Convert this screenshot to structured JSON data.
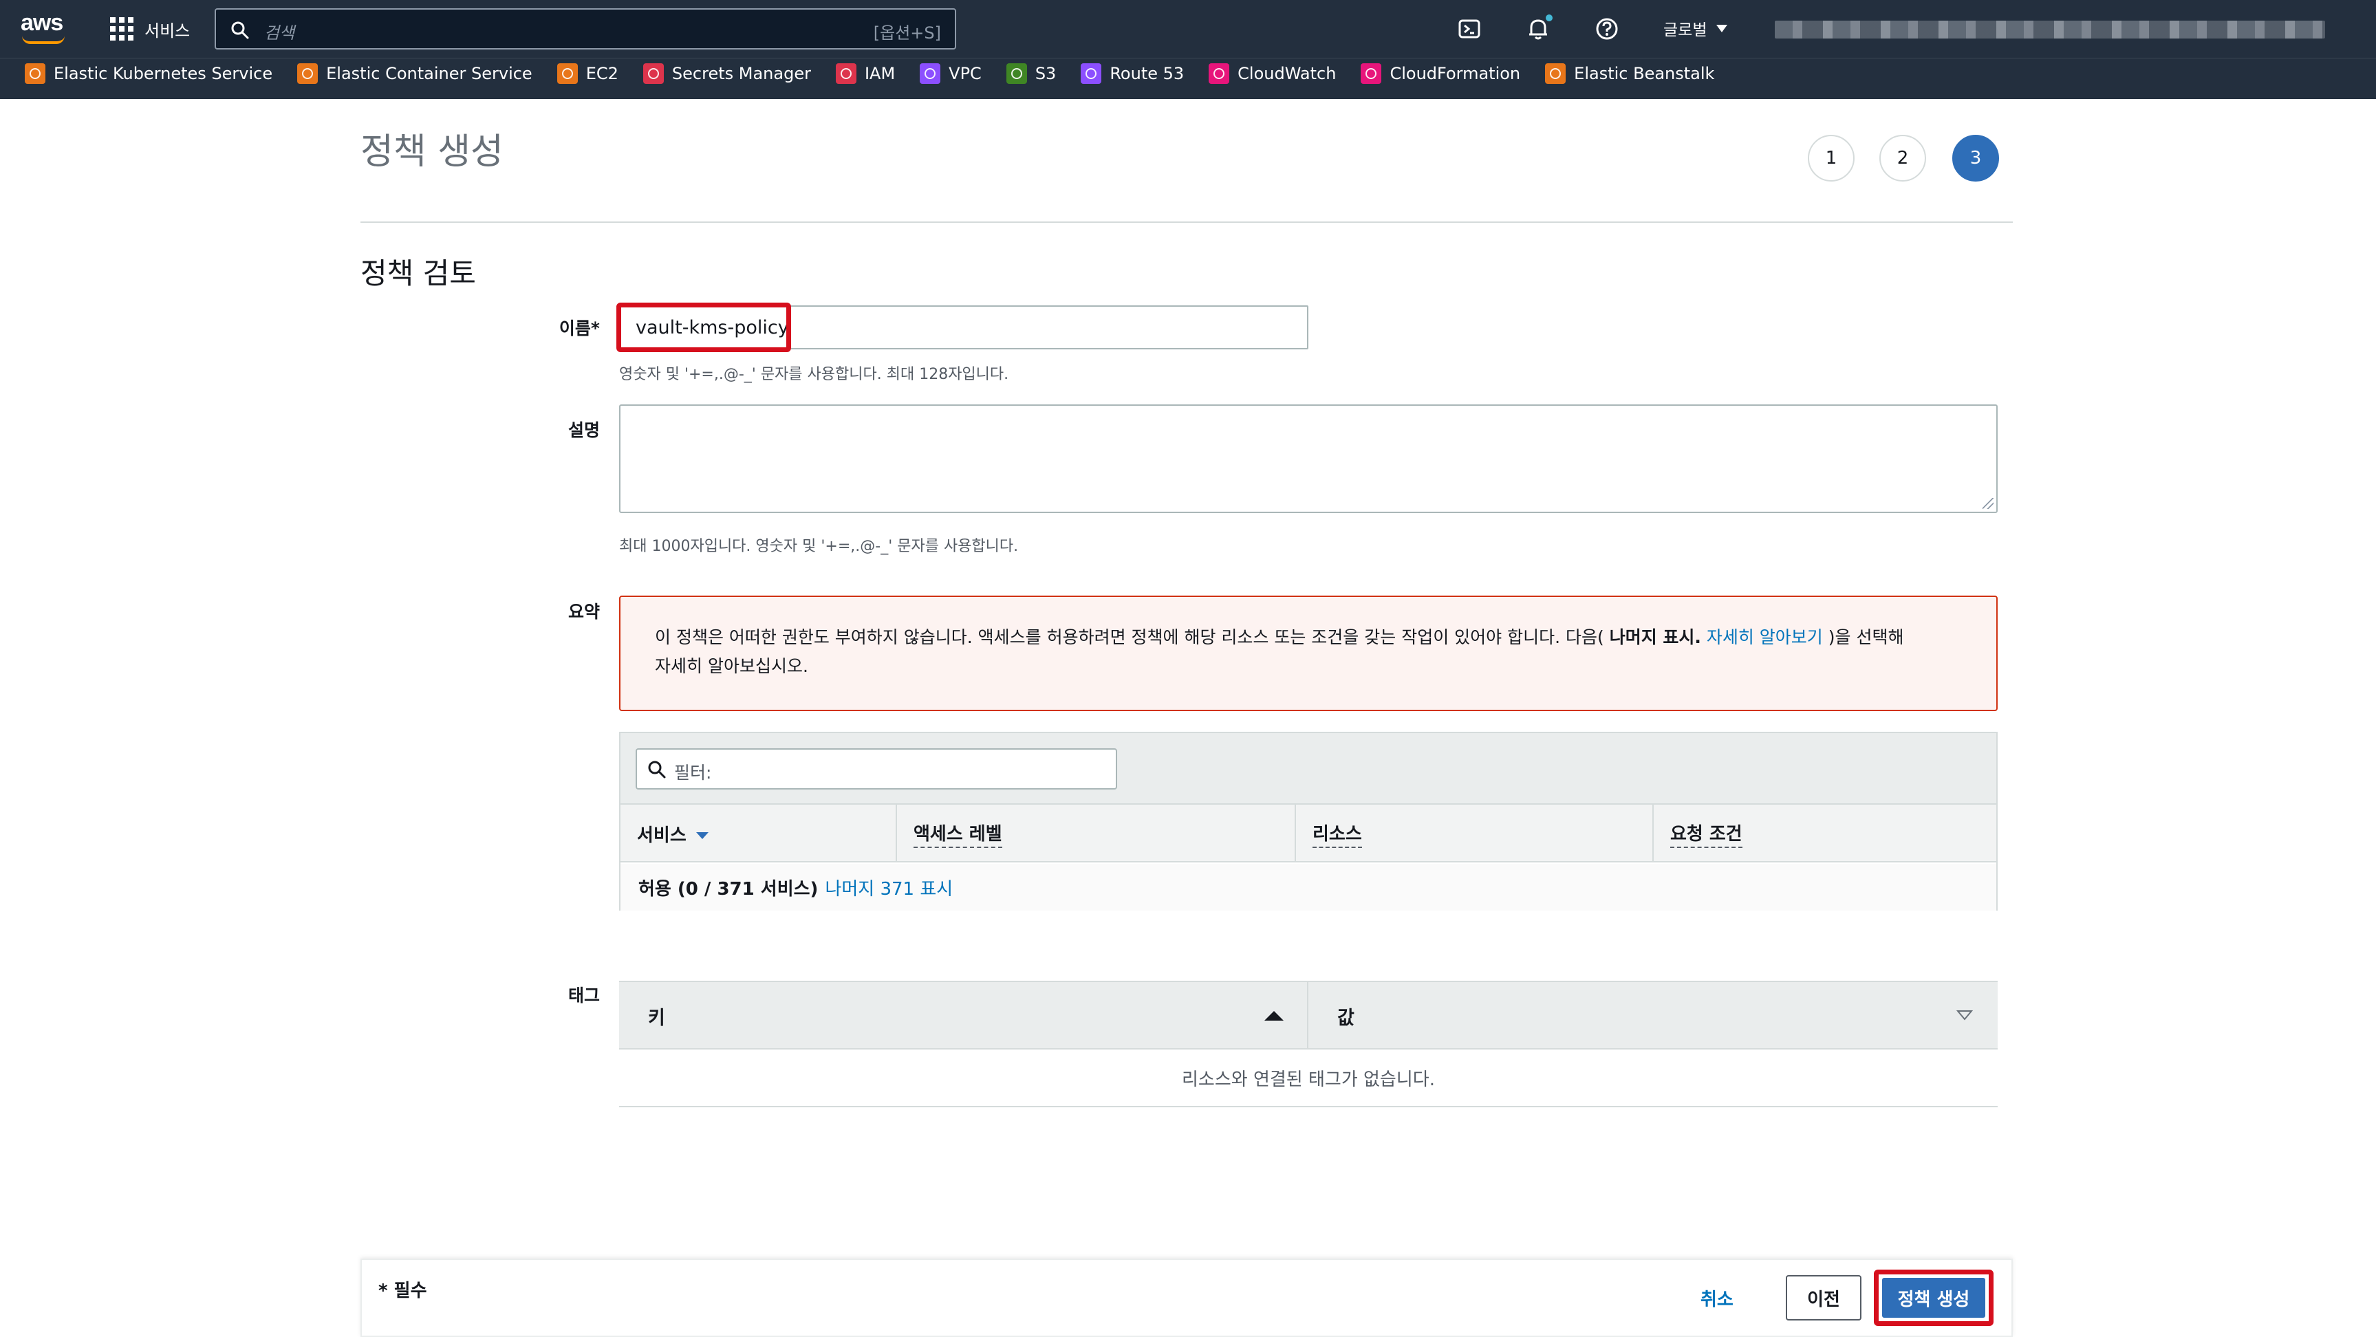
{
  "topnav": {
    "logo": "aws",
    "services_label": "서비스",
    "search_placeholder": "검색",
    "search_shortcut": "[옵션+S]",
    "region_label": "글로벌",
    "icons": [
      "cloudshell-icon",
      "notifications-bell-icon",
      "help-circle-icon"
    ]
  },
  "favorites": [
    {
      "label": "Elastic Kubernetes Service",
      "icon": "eks-icon",
      "color": "#e8761a"
    },
    {
      "label": "Elastic Container Service",
      "icon": "ecs-icon",
      "color": "#e8761a"
    },
    {
      "label": "EC2",
      "icon": "ec2-icon",
      "color": "#e8761a"
    },
    {
      "label": "Secrets Manager",
      "icon": "secrets-manager-icon",
      "color": "#dd344c"
    },
    {
      "label": "IAM",
      "icon": "iam-icon",
      "color": "#dd344c"
    },
    {
      "label": "VPC",
      "icon": "vpc-icon",
      "color": "#8c4fff"
    },
    {
      "label": "S3",
      "icon": "s3-icon",
      "color": "#3f8624"
    },
    {
      "label": "Route 53",
      "icon": "route53-icon",
      "color": "#8c4fff"
    },
    {
      "label": "CloudWatch",
      "icon": "cloudwatch-icon",
      "color": "#e7157b"
    },
    {
      "label": "CloudFormation",
      "icon": "cloudformation-icon",
      "color": "#e7157b"
    },
    {
      "label": "Elastic Beanstalk",
      "icon": "beanstalk-icon",
      "color": "#e8761a"
    }
  ],
  "page": {
    "title": "정책 생성",
    "steps": [
      "1",
      "2",
      "3"
    ],
    "active_step": "3",
    "section_title": "정책 검토"
  },
  "form": {
    "name_label": "이름*",
    "name_value": "vault-kms-policy",
    "name_hint": "영숫자 및 '+=,.@-_' 문자를 사용합니다. 최대 128자입니다.",
    "desc_label": "설명",
    "desc_value": "",
    "desc_hint": "최대 1000자입니다. 영숫자 및 '+=,.@-_' 문자를 사용합니다.",
    "summary_label": "요약",
    "tags_label": "태그"
  },
  "alert": {
    "text_before": "이 정책은 어떠한 권한도 부여하지 않습니다. 액세스를 허용하려면 정책에 해당 리소스 또는 조건을 갖는 작업이 있어야 합니다. 다음(",
    "bold": "나머지 표시.",
    "link": "자세히 알아보기",
    "text_after": ")을 선택해",
    "line2": "자세히 알아보십시오."
  },
  "summary_table": {
    "filter_placeholder": "필터:",
    "columns": [
      "서비스",
      "액세스 레벨",
      "리소스",
      "요청 조건"
    ],
    "row_label": "허용 (0 / 371 서비스)",
    "row_link": "나머지 371 표시"
  },
  "tags_table": {
    "col_key": "키",
    "col_value": "값",
    "empty": "리소스와 연결된 태그가 없습니다."
  },
  "footer": {
    "required": "* 필수",
    "cancel": "취소",
    "previous": "이전",
    "create": "정책 생성"
  },
  "colors": {
    "nav_bg": "#232f3e",
    "primary": "#2e6eb8",
    "link": "#0073bb",
    "highlight": "#d60f1d",
    "alert_border": "#d13212"
  }
}
